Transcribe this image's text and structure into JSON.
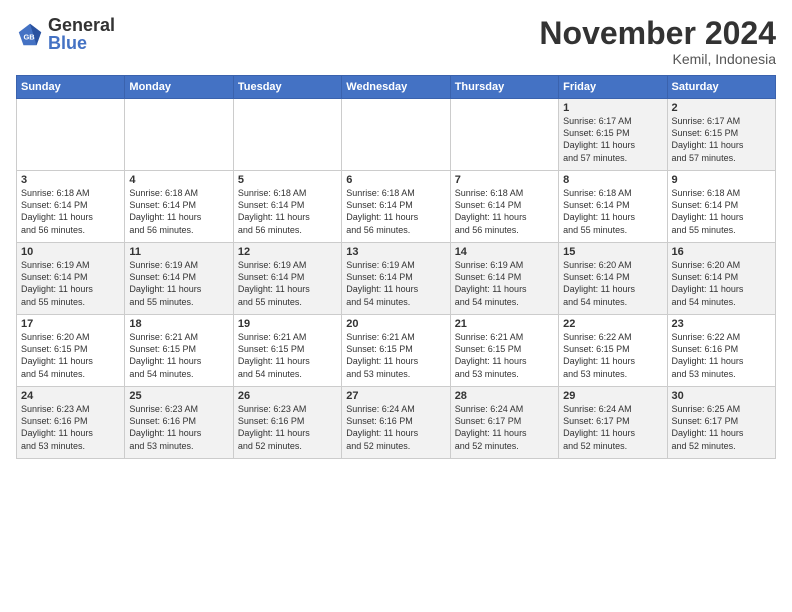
{
  "logo": {
    "general": "General",
    "blue": "Blue"
  },
  "title": "November 2024",
  "location": "Kemil, Indonesia",
  "days_header": [
    "Sunday",
    "Monday",
    "Tuesday",
    "Wednesday",
    "Thursday",
    "Friday",
    "Saturday"
  ],
  "weeks": [
    [
      {
        "day": "",
        "info": ""
      },
      {
        "day": "",
        "info": ""
      },
      {
        "day": "",
        "info": ""
      },
      {
        "day": "",
        "info": ""
      },
      {
        "day": "",
        "info": ""
      },
      {
        "day": "1",
        "info": "Sunrise: 6:17 AM\nSunset: 6:15 PM\nDaylight: 11 hours\nand 57 minutes."
      },
      {
        "day": "2",
        "info": "Sunrise: 6:17 AM\nSunset: 6:15 PM\nDaylight: 11 hours\nand 57 minutes."
      }
    ],
    [
      {
        "day": "3",
        "info": "Sunrise: 6:18 AM\nSunset: 6:14 PM\nDaylight: 11 hours\nand 56 minutes."
      },
      {
        "day": "4",
        "info": "Sunrise: 6:18 AM\nSunset: 6:14 PM\nDaylight: 11 hours\nand 56 minutes."
      },
      {
        "day": "5",
        "info": "Sunrise: 6:18 AM\nSunset: 6:14 PM\nDaylight: 11 hours\nand 56 minutes."
      },
      {
        "day": "6",
        "info": "Sunrise: 6:18 AM\nSunset: 6:14 PM\nDaylight: 11 hours\nand 56 minutes."
      },
      {
        "day": "7",
        "info": "Sunrise: 6:18 AM\nSunset: 6:14 PM\nDaylight: 11 hours\nand 56 minutes."
      },
      {
        "day": "8",
        "info": "Sunrise: 6:18 AM\nSunset: 6:14 PM\nDaylight: 11 hours\nand 55 minutes."
      },
      {
        "day": "9",
        "info": "Sunrise: 6:18 AM\nSunset: 6:14 PM\nDaylight: 11 hours\nand 55 minutes."
      }
    ],
    [
      {
        "day": "10",
        "info": "Sunrise: 6:19 AM\nSunset: 6:14 PM\nDaylight: 11 hours\nand 55 minutes."
      },
      {
        "day": "11",
        "info": "Sunrise: 6:19 AM\nSunset: 6:14 PM\nDaylight: 11 hours\nand 55 minutes."
      },
      {
        "day": "12",
        "info": "Sunrise: 6:19 AM\nSunset: 6:14 PM\nDaylight: 11 hours\nand 55 minutes."
      },
      {
        "day": "13",
        "info": "Sunrise: 6:19 AM\nSunset: 6:14 PM\nDaylight: 11 hours\nand 54 minutes."
      },
      {
        "day": "14",
        "info": "Sunrise: 6:19 AM\nSunset: 6:14 PM\nDaylight: 11 hours\nand 54 minutes."
      },
      {
        "day": "15",
        "info": "Sunrise: 6:20 AM\nSunset: 6:14 PM\nDaylight: 11 hours\nand 54 minutes."
      },
      {
        "day": "16",
        "info": "Sunrise: 6:20 AM\nSunset: 6:14 PM\nDaylight: 11 hours\nand 54 minutes."
      }
    ],
    [
      {
        "day": "17",
        "info": "Sunrise: 6:20 AM\nSunset: 6:15 PM\nDaylight: 11 hours\nand 54 minutes."
      },
      {
        "day": "18",
        "info": "Sunrise: 6:21 AM\nSunset: 6:15 PM\nDaylight: 11 hours\nand 54 minutes."
      },
      {
        "day": "19",
        "info": "Sunrise: 6:21 AM\nSunset: 6:15 PM\nDaylight: 11 hours\nand 54 minutes."
      },
      {
        "day": "20",
        "info": "Sunrise: 6:21 AM\nSunset: 6:15 PM\nDaylight: 11 hours\nand 53 minutes."
      },
      {
        "day": "21",
        "info": "Sunrise: 6:21 AM\nSunset: 6:15 PM\nDaylight: 11 hours\nand 53 minutes."
      },
      {
        "day": "22",
        "info": "Sunrise: 6:22 AM\nSunset: 6:15 PM\nDaylight: 11 hours\nand 53 minutes."
      },
      {
        "day": "23",
        "info": "Sunrise: 6:22 AM\nSunset: 6:16 PM\nDaylight: 11 hours\nand 53 minutes."
      }
    ],
    [
      {
        "day": "24",
        "info": "Sunrise: 6:23 AM\nSunset: 6:16 PM\nDaylight: 11 hours\nand 53 minutes."
      },
      {
        "day": "25",
        "info": "Sunrise: 6:23 AM\nSunset: 6:16 PM\nDaylight: 11 hours\nand 53 minutes."
      },
      {
        "day": "26",
        "info": "Sunrise: 6:23 AM\nSunset: 6:16 PM\nDaylight: 11 hours\nand 52 minutes."
      },
      {
        "day": "27",
        "info": "Sunrise: 6:24 AM\nSunset: 6:16 PM\nDaylight: 11 hours\nand 52 minutes."
      },
      {
        "day": "28",
        "info": "Sunrise: 6:24 AM\nSunset: 6:17 PM\nDaylight: 11 hours\nand 52 minutes."
      },
      {
        "day": "29",
        "info": "Sunrise: 6:24 AM\nSunset: 6:17 PM\nDaylight: 11 hours\nand 52 minutes."
      },
      {
        "day": "30",
        "info": "Sunrise: 6:25 AM\nSunset: 6:17 PM\nDaylight: 11 hours\nand 52 minutes."
      }
    ]
  ]
}
